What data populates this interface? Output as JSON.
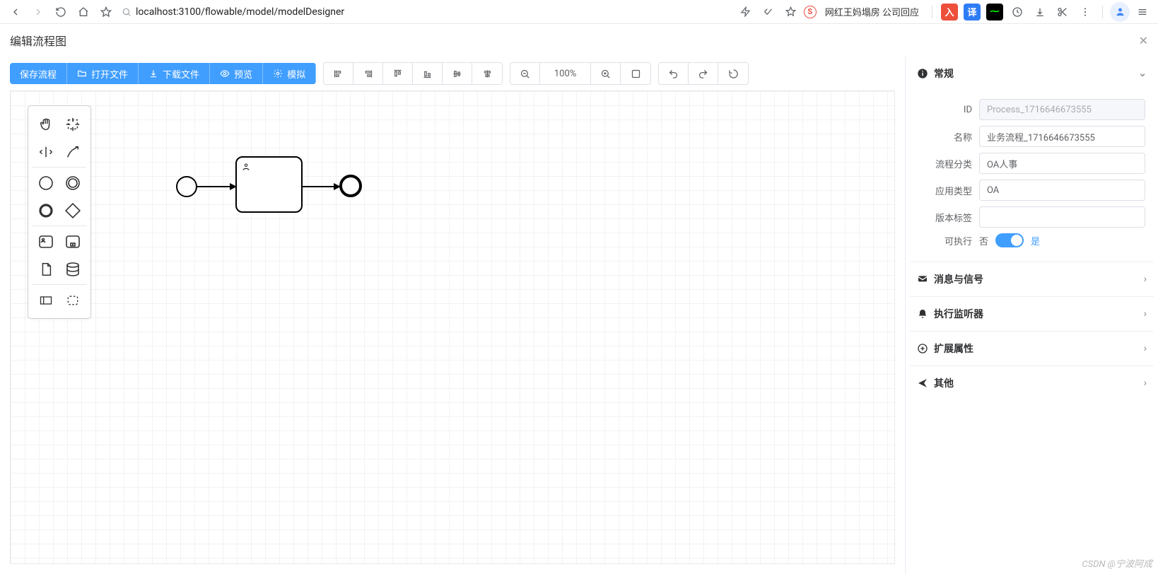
{
  "browser": {
    "url": "localhost:3100/flowable/model/modelDesigner",
    "news": "网红王妈塌房 公司回应"
  },
  "page": {
    "title": "编辑流程图"
  },
  "toolbar": {
    "save": "保存流程",
    "open": "打开文件",
    "download": "下载文件",
    "preview": "预览",
    "simulate": "模拟",
    "zoom": "100%"
  },
  "props": {
    "general": {
      "title": "常规",
      "id_label": "ID",
      "id_value": "Process_1716646673555",
      "name_label": "名称",
      "name_value": "业务流程_1716646673555",
      "category_label": "流程分类",
      "category_value": "OA人事",
      "apptype_label": "应用类型",
      "apptype_value": "OA",
      "version_label": "版本标签",
      "version_value": "",
      "exec_label": "可执行",
      "exec_no": "否",
      "exec_yes": "是"
    },
    "sections": {
      "messages": "消息与信号",
      "listeners": "执行监听器",
      "ext": "扩展属性",
      "other": "其他"
    }
  },
  "watermark": "CSDN @宁波阿成"
}
